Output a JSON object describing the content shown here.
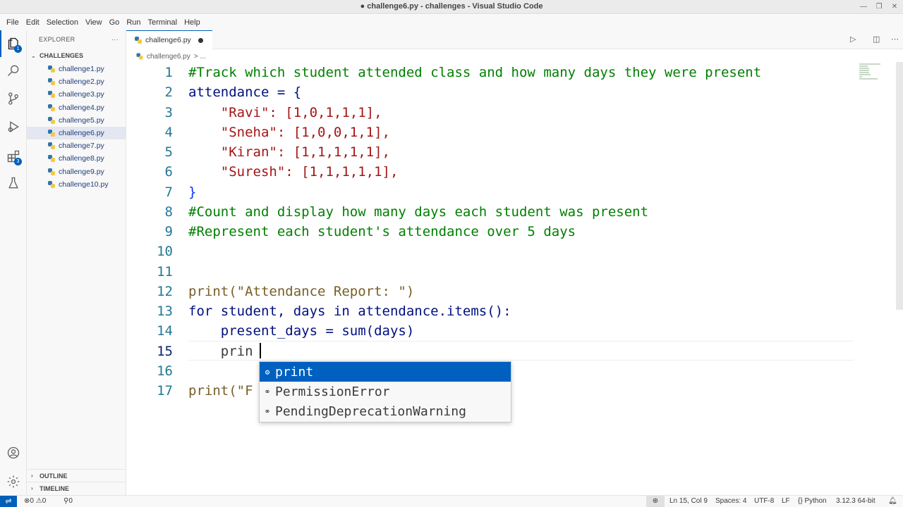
{
  "window": {
    "title": "● challenge6.py - challenges - Visual Studio Code"
  },
  "menu": [
    "File",
    "Edit",
    "Selection",
    "View",
    "Go",
    "Run",
    "Terminal",
    "Help"
  ],
  "activity": {
    "explorer_badge": "1",
    "extensions_badge": "3"
  },
  "sidebar": {
    "header": "EXPLORER",
    "more": "···",
    "folder": "CHALLENGES",
    "files": [
      "challenge1.py",
      "challenge2.py",
      "challenge3.py",
      "challenge4.py",
      "challenge5.py",
      "challenge6.py",
      "challenge7.py",
      "challenge8.py",
      "challenge9.py",
      "challenge10.py"
    ],
    "selected_file": "challenge6.py",
    "outline": "OUTLINE",
    "timeline": "TIMELINE"
  },
  "editor": {
    "tab_label": "challenge6.py",
    "breadcrumb_file": "challenge6.py",
    "breadcrumb_rest": "> ...",
    "line_numbers": [
      "1",
      "2",
      "3",
      "4",
      "5",
      "6",
      "7",
      "8",
      "9",
      "10",
      "11",
      "12",
      "13",
      "14",
      "15",
      "16",
      "17"
    ],
    "current_line": "15",
    "lines": [
      "#Track which student attended class and how many days they were present",
      "attendance = {",
      "    \"Ravi\": [1,0,1,1,1],",
      "    \"Sneha\": [1,0,0,1,1],",
      "    \"Kiran\": [1,1,1,1,1],",
      "    \"Suresh\": [1,1,1,1,1],",
      "}",
      "#Count and display how many days each student was present",
      "#Represent each student's attendance over 5 days",
      "",
      "",
      "print(\"Attendance Report: \")",
      "for student, days in attendance.items():",
      "    present_days = sum(days)",
      "    prin",
      "",
      "print(\"F"
    ]
  },
  "suggestions": [
    {
      "icon": "⚙",
      "text": "print",
      "selected": true
    },
    {
      "icon": "⚭",
      "text": "PermissionError",
      "selected": false
    },
    {
      "icon": "⚭",
      "text": "PendingDeprecationWarning",
      "selected": false
    }
  ],
  "status": {
    "errors": "0",
    "warnings": "0",
    "ports": "0",
    "position": "Ln 15, Col 9",
    "spaces": "Spaces: 4",
    "encoding": "UTF-8",
    "eol": "LF",
    "language": "Python",
    "interpreter": "3.12.3 64-bit"
  }
}
